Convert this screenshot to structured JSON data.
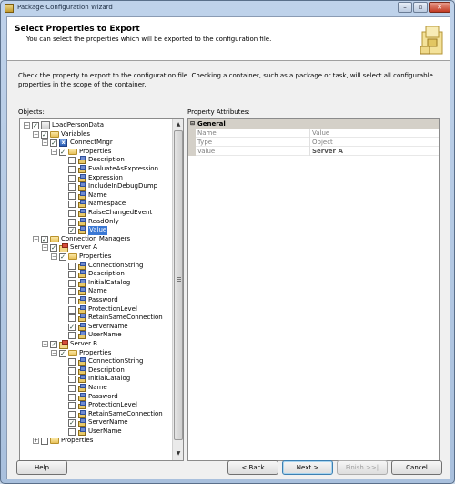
{
  "window": {
    "title": "Package Configuration Wizard",
    "minimize": "–",
    "maximize": "▫",
    "close": "✕"
  },
  "header": {
    "title": "Select Properties to Export",
    "subtitle": "You can select the properties which will be exported to the configuration file."
  },
  "description": "Check the property to export to the configuration file. Checking a container, such as a package or task, will select all configurable properties in the scope of the container.",
  "objects_label": "Objects:",
  "attributes_label": "Property Attributes:",
  "tree": [
    {
      "label": "LoadPersonData",
      "level": 0,
      "expander": "−",
      "checked": true,
      "icon": "package-icon"
    },
    {
      "label": "Variables",
      "level": 1,
      "expander": "−",
      "checked": true,
      "icon": "folder-icon"
    },
    {
      "label": "ConnectMngr",
      "level": 2,
      "expander": "−",
      "checked": true,
      "icon": "variable-icon"
    },
    {
      "label": "Properties",
      "level": 3,
      "expander": "−",
      "checked": true,
      "icon": "folder-icon"
    },
    {
      "label": "Description",
      "level": 4,
      "checked": false,
      "icon": "property-icon"
    },
    {
      "label": "EvaluateAsExpression",
      "level": 4,
      "checked": false,
      "icon": "property-icon"
    },
    {
      "label": "Expression",
      "level": 4,
      "checked": false,
      "icon": "property-icon"
    },
    {
      "label": "IncludeInDebugDump",
      "level": 4,
      "checked": false,
      "icon": "property-icon"
    },
    {
      "label": "Name",
      "level": 4,
      "checked": false,
      "icon": "property-icon"
    },
    {
      "label": "Namespace",
      "level": 4,
      "checked": false,
      "icon": "property-icon"
    },
    {
      "label": "RaiseChangedEvent",
      "level": 4,
      "checked": false,
      "icon": "property-icon"
    },
    {
      "label": "ReadOnly",
      "level": 4,
      "checked": false,
      "icon": "property-icon"
    },
    {
      "label": "Value",
      "level": 4,
      "checked": true,
      "icon": "property-icon",
      "selected": true
    },
    {
      "label": "Connection Managers",
      "level": 1,
      "expander": "−",
      "checked": true,
      "icon": "folder-icon"
    },
    {
      "label": "Server A",
      "level": 2,
      "expander": "−",
      "checked": true,
      "icon": "connection-icon"
    },
    {
      "label": "Properties",
      "level": 3,
      "expander": "−",
      "checked": true,
      "icon": "folder-icon"
    },
    {
      "label": "ConnectionString",
      "level": 4,
      "checked": false,
      "icon": "property-icon"
    },
    {
      "label": "Description",
      "level": 4,
      "checked": false,
      "icon": "property-icon"
    },
    {
      "label": "InitialCatalog",
      "level": 4,
      "checked": false,
      "icon": "property-icon"
    },
    {
      "label": "Name",
      "level": 4,
      "checked": false,
      "icon": "property-icon"
    },
    {
      "label": "Password",
      "level": 4,
      "checked": false,
      "icon": "property-icon"
    },
    {
      "label": "ProtectionLevel",
      "level": 4,
      "checked": false,
      "icon": "property-icon"
    },
    {
      "label": "RetainSameConnection",
      "level": 4,
      "checked": false,
      "icon": "property-icon"
    },
    {
      "label": "ServerName",
      "level": 4,
      "checked": true,
      "icon": "property-icon"
    },
    {
      "label": "UserName",
      "level": 4,
      "checked": false,
      "icon": "property-icon"
    },
    {
      "label": "Server B",
      "level": 2,
      "expander": "−",
      "checked": true,
      "icon": "connection-icon"
    },
    {
      "label": "Properties",
      "level": 3,
      "expander": "−",
      "checked": true,
      "icon": "folder-icon"
    },
    {
      "label": "ConnectionString",
      "level": 4,
      "checked": false,
      "icon": "property-icon"
    },
    {
      "label": "Description",
      "level": 4,
      "checked": false,
      "icon": "property-icon"
    },
    {
      "label": "InitialCatalog",
      "level": 4,
      "checked": false,
      "icon": "property-icon"
    },
    {
      "label": "Name",
      "level": 4,
      "checked": false,
      "icon": "property-icon"
    },
    {
      "label": "Password",
      "level": 4,
      "checked": false,
      "icon": "property-icon"
    },
    {
      "label": "ProtectionLevel",
      "level": 4,
      "checked": false,
      "icon": "property-icon"
    },
    {
      "label": "RetainSameConnection",
      "level": 4,
      "checked": false,
      "icon": "property-icon"
    },
    {
      "label": "ServerName",
      "level": 4,
      "checked": true,
      "icon": "property-icon"
    },
    {
      "label": "UserName",
      "level": 4,
      "checked": false,
      "icon": "property-icon"
    },
    {
      "label": "Properties",
      "level": 1,
      "expander": "+",
      "checked": false,
      "icon": "folder-icon"
    }
  ],
  "attributes": {
    "category": "General",
    "rows": [
      {
        "name": "Name",
        "value": "Value",
        "bold": false
      },
      {
        "name": "Type",
        "value": "Object",
        "bold": false
      },
      {
        "name": "Value",
        "value": "Server A",
        "bold": true
      }
    ]
  },
  "buttons": {
    "help": "Help",
    "back": "< Back",
    "next": "Next >",
    "finish": "Finish >>|",
    "cancel": "Cancel"
  },
  "colors": {
    "selection": "#3a78d4",
    "header_bg": "#ffffff",
    "dialog_bg": "#f0f0f0"
  }
}
